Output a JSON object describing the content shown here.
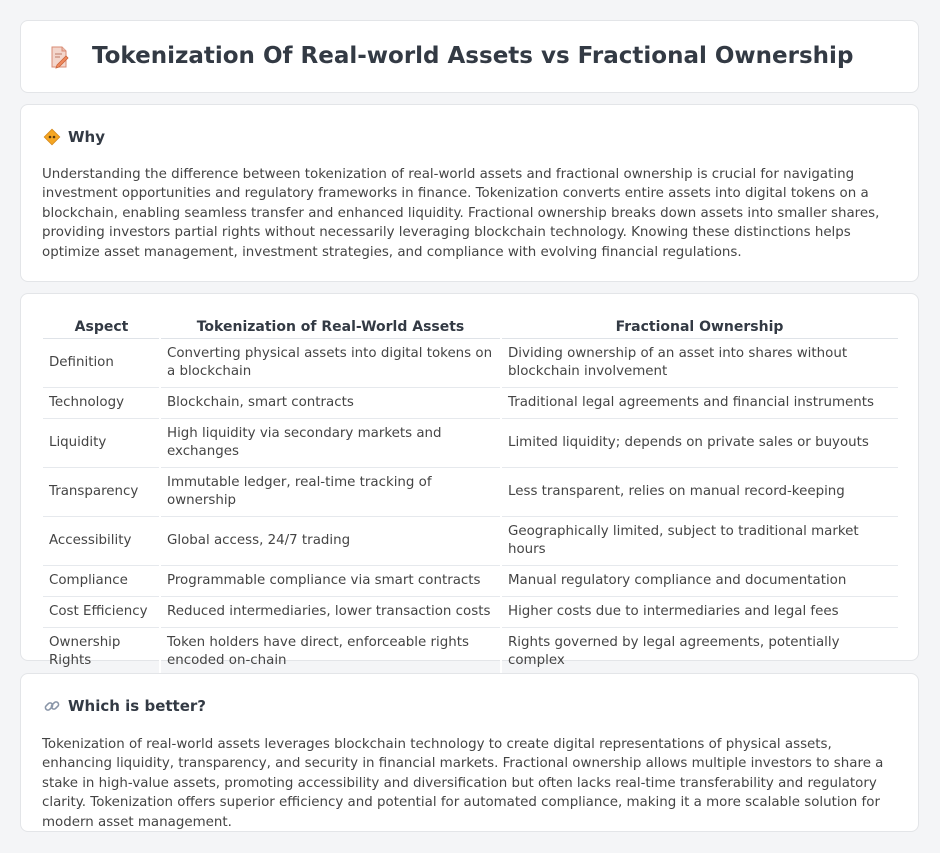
{
  "header": {
    "title": "Tokenization Of Real-world Assets vs Fractional Ownership",
    "icon": "document-pencil-icon"
  },
  "why": {
    "heading": "Why",
    "icon": "diamond-sign-icon",
    "text": "Understanding the difference between tokenization of real-world assets and fractional ownership is crucial for navigating investment opportunities and regulatory frameworks in finance. Tokenization converts entire assets into digital tokens on a blockchain, enabling seamless transfer and enhanced liquidity. Fractional ownership breaks down assets into smaller shares, providing investors partial rights without necessarily leveraging blockchain technology. Knowing these distinctions helps optimize asset management, investment strategies, and compliance with evolving financial regulations."
  },
  "table": {
    "headers": [
      "Aspect",
      "Tokenization of Real-World Assets",
      "Fractional Ownership"
    ],
    "rows": [
      [
        "Definition",
        "Converting physical assets into digital tokens on a blockchain",
        "Dividing ownership of an asset into shares without blockchain involvement"
      ],
      [
        "Technology",
        "Blockchain, smart contracts",
        "Traditional legal agreements and financial instruments"
      ],
      [
        "Liquidity",
        "High liquidity via secondary markets and exchanges",
        "Limited liquidity; depends on private sales or buyouts"
      ],
      [
        "Transparency",
        "Immutable ledger, real-time tracking of ownership",
        "Less transparent, relies on manual record-keeping"
      ],
      [
        "Accessibility",
        "Global access, 24/7 trading",
        "Geographically limited, subject to traditional market hours"
      ],
      [
        "Compliance",
        "Programmable compliance via smart contracts",
        "Manual regulatory compliance and documentation"
      ],
      [
        "Cost Efficiency",
        "Reduced intermediaries, lower transaction costs",
        "Higher costs due to intermediaries and legal fees"
      ],
      [
        "Ownership Rights",
        "Token holders have direct, enforceable rights encoded on-chain",
        "Rights governed by legal agreements, potentially complex"
      ]
    ]
  },
  "better": {
    "heading": "Which is better?",
    "icon": "link-icon",
    "text": "Tokenization of real-world assets leverages blockchain technology to create digital representations of physical assets, enhancing liquidity, transparency, and security in financial markets. Fractional ownership allows multiple investors to share a stake in high-value assets, promoting accessibility and diversification but often lacks real-time transferability and regulatory clarity. Tokenization offers superior efficiency and potential for automated compliance, making it a more scalable solution for modern asset management."
  },
  "colors": {
    "background": "#f4f5f7",
    "card": "#ffffff",
    "title": "#333a44",
    "text": "#444444",
    "icon_accent": "#f5a623"
  }
}
